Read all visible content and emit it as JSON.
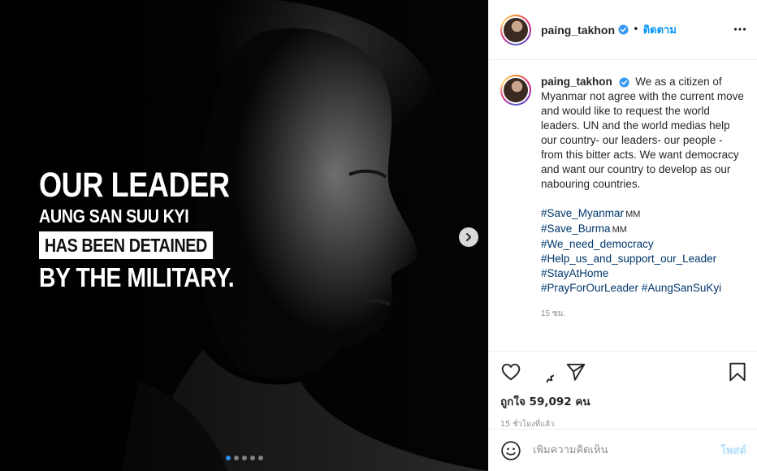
{
  "header": {
    "username": "paing_takhon",
    "separator": "•",
    "follow_label": "ติดตาม"
  },
  "image": {
    "overlay_line1": "OUR LEADER",
    "overlay_line2": "AUNG SAN SUU KYI",
    "overlay_line3": "HAS BEEN DETAINED",
    "overlay_line4": "BY THE MILITARY.",
    "carousel_total": 5,
    "carousel_active": 1
  },
  "caption": {
    "username": "paing_takhon",
    "text": "We as a citizen of Myanmar not agree with the current move and would like to request the world leaders. UN and the world medias help our country- our leaders- our people - from this bitter acts. We want democracy and want our country to develop as our nabouring countries.",
    "hashtags": [
      {
        "tag": "#Save_Myanmar",
        "suffix": "MM"
      },
      {
        "tag": "#Save_Burma",
        "suffix": "MM"
      },
      {
        "tag": "#We_need_democracy",
        "suffix": ""
      },
      {
        "tag": "#Help_us_and_support_our_Leader",
        "suffix": ""
      },
      {
        "tag": "#StayAtHome",
        "suffix": ""
      }
    ],
    "last_line_tag1": "#PrayForOurLeader",
    "last_line_tag2": "#AungSanSuKyi",
    "time": "15 ชม."
  },
  "stats": {
    "likes": "ถูกใจ 59,092 คน",
    "posted": "15 ชั่วโมงที่แล้ว"
  },
  "comment": {
    "placeholder": "เพิ่มความคิดเห็น",
    "post_label": "โพสต์"
  },
  "colors": {
    "link": "#00376b",
    "follow": "#0095f6",
    "post_disabled": "#b2dffc",
    "verified": "#3897f0",
    "carousel_active": "#2f8cf0"
  },
  "icons": [
    "chevron-right-icon",
    "more-icon",
    "verified-icon",
    "heart-icon",
    "comment-icon",
    "share-icon",
    "bookmark-icon",
    "emoji-icon"
  ]
}
